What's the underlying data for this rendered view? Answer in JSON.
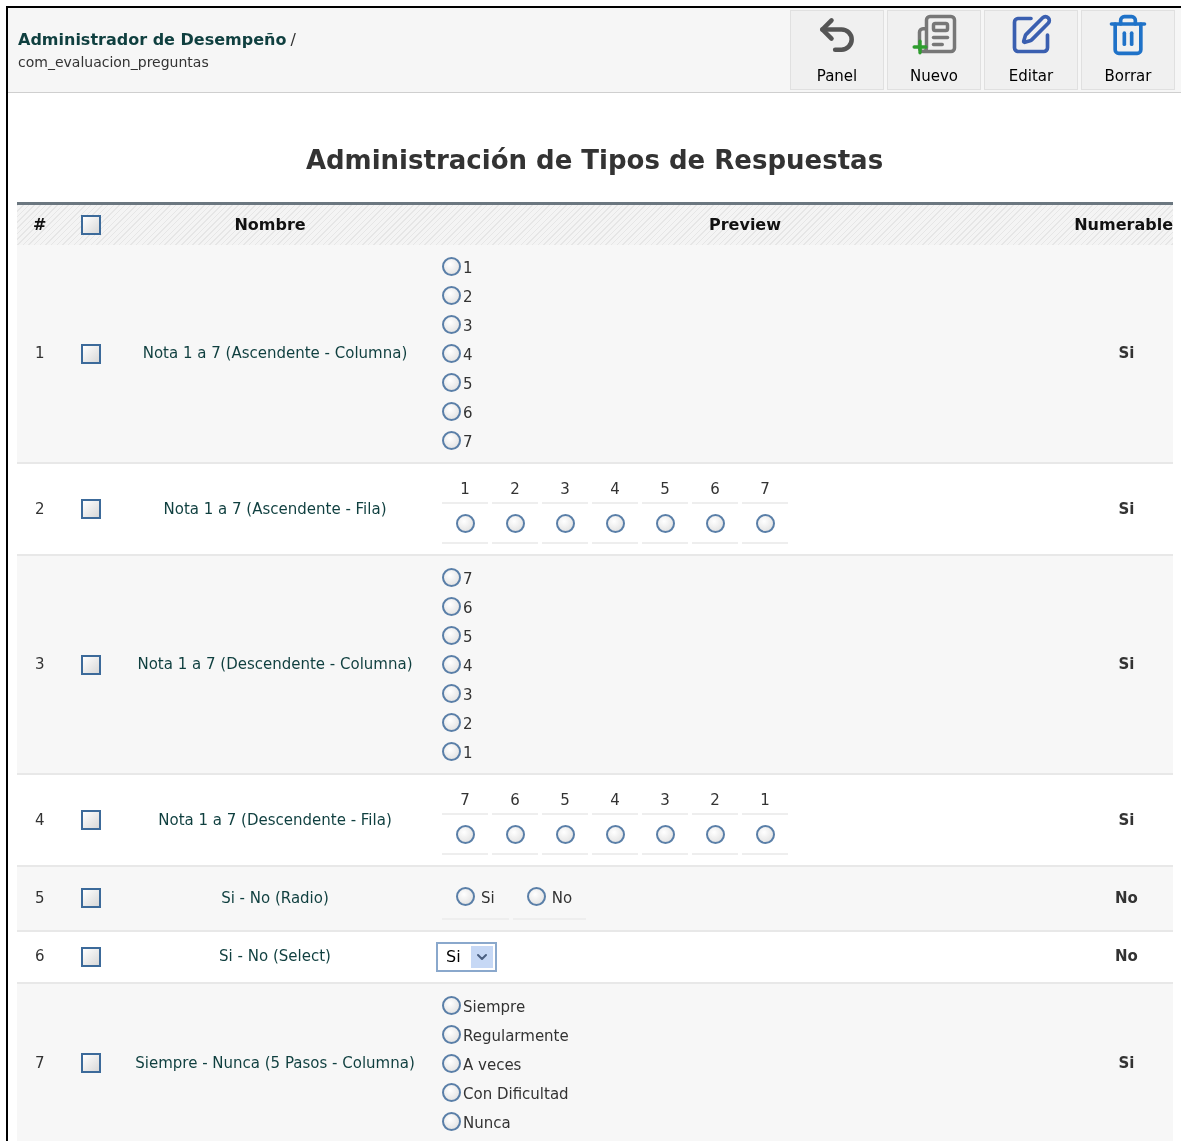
{
  "header": {
    "title": "Administrador de Desempeño",
    "separator": "/",
    "subtitle": "com_evaluacion_preguntas"
  },
  "toolbar": [
    {
      "label": "Panel",
      "kind": "back"
    },
    {
      "label": "Nuevo",
      "kind": "new"
    },
    {
      "label": "Editar",
      "kind": "edit"
    },
    {
      "label": "Borrar",
      "kind": "delete"
    }
  ],
  "page_title": "Administración de Tipos de Respuestas",
  "table": {
    "columns": [
      "#",
      "Nombre",
      "Preview",
      "Numerable"
    ],
    "select_all": {
      "checked": false
    },
    "rows": [
      {
        "index": "1",
        "checked": false,
        "name": "Nota 1 a 7 (Ascendente - Columna)",
        "numerable": "Si",
        "preview": {
          "kind": "column",
          "options": [
            {
              "label": "1",
              "selected": false
            },
            {
              "label": "2",
              "selected": false
            },
            {
              "label": "3",
              "selected": false
            },
            {
              "label": "4",
              "selected": false
            },
            {
              "label": "5",
              "selected": false
            },
            {
              "label": "6",
              "selected": false
            },
            {
              "label": "7",
              "selected": false
            }
          ]
        }
      },
      {
        "index": "2",
        "checked": false,
        "name": "Nota 1 a 7 (Ascendente - Fila)",
        "numerable": "Si",
        "preview": {
          "kind": "row",
          "options": [
            {
              "label": "1",
              "selected": false
            },
            {
              "label": "2",
              "selected": false
            },
            {
              "label": "3",
              "selected": false
            },
            {
              "label": "4",
              "selected": false
            },
            {
              "label": "5",
              "selected": false
            },
            {
              "label": "6",
              "selected": false
            },
            {
              "label": "7",
              "selected": false
            }
          ]
        }
      },
      {
        "index": "3",
        "checked": false,
        "name": "Nota 1 a 7 (Descendente - Columna)",
        "numerable": "Si",
        "preview": {
          "kind": "column",
          "options": [
            {
              "label": "7",
              "selected": false
            },
            {
              "label": "6",
              "selected": false
            },
            {
              "label": "5",
              "selected": false
            },
            {
              "label": "4",
              "selected": false
            },
            {
              "label": "3",
              "selected": false
            },
            {
              "label": "2",
              "selected": false
            },
            {
              "label": "1",
              "selected": false
            }
          ]
        }
      },
      {
        "index": "4",
        "checked": false,
        "name": "Nota 1 a 7 (Descendente - Fila)",
        "numerable": "Si",
        "preview": {
          "kind": "row",
          "options": [
            {
              "label": "7",
              "selected": false
            },
            {
              "label": "6",
              "selected": false
            },
            {
              "label": "5",
              "selected": false
            },
            {
              "label": "4",
              "selected": false
            },
            {
              "label": "3",
              "selected": false
            },
            {
              "label": "2",
              "selected": false
            },
            {
              "label": "1",
              "selected": false
            }
          ]
        }
      },
      {
        "index": "5",
        "checked": false,
        "name": "Si - No (Radio)",
        "numerable": "No",
        "preview": {
          "kind": "inline",
          "options": [
            {
              "label": "Si",
              "selected": false
            },
            {
              "label": "No",
              "selected": false
            }
          ]
        }
      },
      {
        "index": "6",
        "checked": false,
        "name": "Si - No (Select)",
        "numerable": "No",
        "preview": {
          "kind": "select",
          "value": "Si"
        }
      },
      {
        "index": "7",
        "checked": false,
        "name": "Siempre - Nunca (5 Pasos - Columna)",
        "numerable": "Si",
        "preview": {
          "kind": "column",
          "options": [
            {
              "label": "Siempre",
              "selected": false
            },
            {
              "label": "Regularmente",
              "selected": false
            },
            {
              "label": "A veces",
              "selected": false
            },
            {
              "label": "Con Dificultad",
              "selected": false
            },
            {
              "label": "Nunca",
              "selected": false
            }
          ]
        }
      }
    ]
  }
}
